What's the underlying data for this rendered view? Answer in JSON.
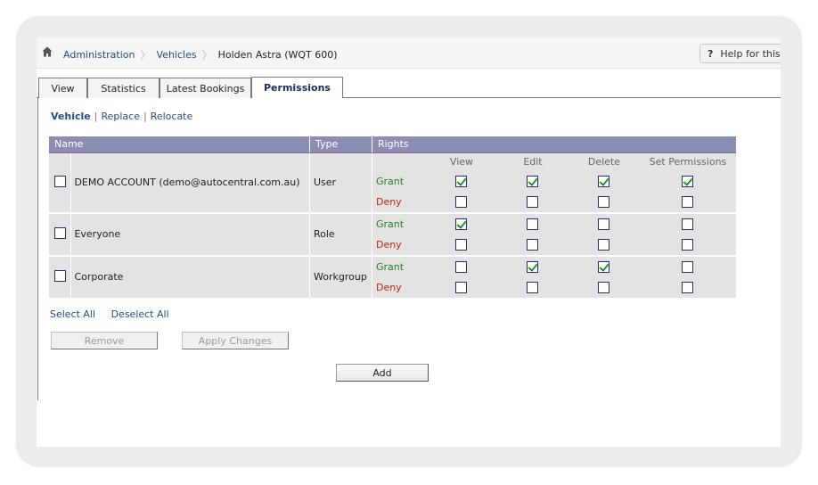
{
  "breadcrumb": {
    "items": [
      "Administration",
      "Vehicles"
    ],
    "current": "Holden Astra (WQT 600)"
  },
  "help": {
    "icon": "?",
    "label": "Help for this p"
  },
  "tabs": [
    {
      "label": "View",
      "active": false
    },
    {
      "label": "Statistics",
      "active": false
    },
    {
      "label": "Latest Bookings",
      "active": false
    },
    {
      "label": "Permissions",
      "active": true
    }
  ],
  "subnav": {
    "items": [
      "Vehicle",
      "Replace",
      "Relocate"
    ],
    "separator": "|"
  },
  "table": {
    "headers": {
      "name": "Name",
      "type": "Type",
      "rights": "Rights"
    },
    "right_columns": [
      "View",
      "Edit",
      "Delete",
      "Set Permissions"
    ],
    "grant_label": "Grant",
    "deny_label": "Deny",
    "rows": [
      {
        "name": "DEMO ACCOUNT (demo@autocentral.com.au)",
        "type": "User",
        "grant": [
          true,
          true,
          true,
          true
        ],
        "deny": [
          false,
          false,
          false,
          false
        ]
      },
      {
        "name": "Everyone",
        "type": "Role",
        "grant": [
          true,
          false,
          false,
          false
        ],
        "deny": [
          false,
          false,
          false,
          false
        ]
      },
      {
        "name": "Corporate",
        "type": "Workgroup",
        "grant": [
          false,
          true,
          true,
          false
        ],
        "deny": [
          false,
          false,
          false,
          false
        ]
      }
    ]
  },
  "select_all": "Select All",
  "deselect_all": "Deselect All",
  "buttons": {
    "remove": "Remove",
    "apply": "Apply Changes",
    "add": "Add"
  },
  "colors": {
    "header_bg": "#8b8db3",
    "link": "#2b4a84",
    "grant": "#2a7a2a",
    "deny": "#b3261e"
  }
}
